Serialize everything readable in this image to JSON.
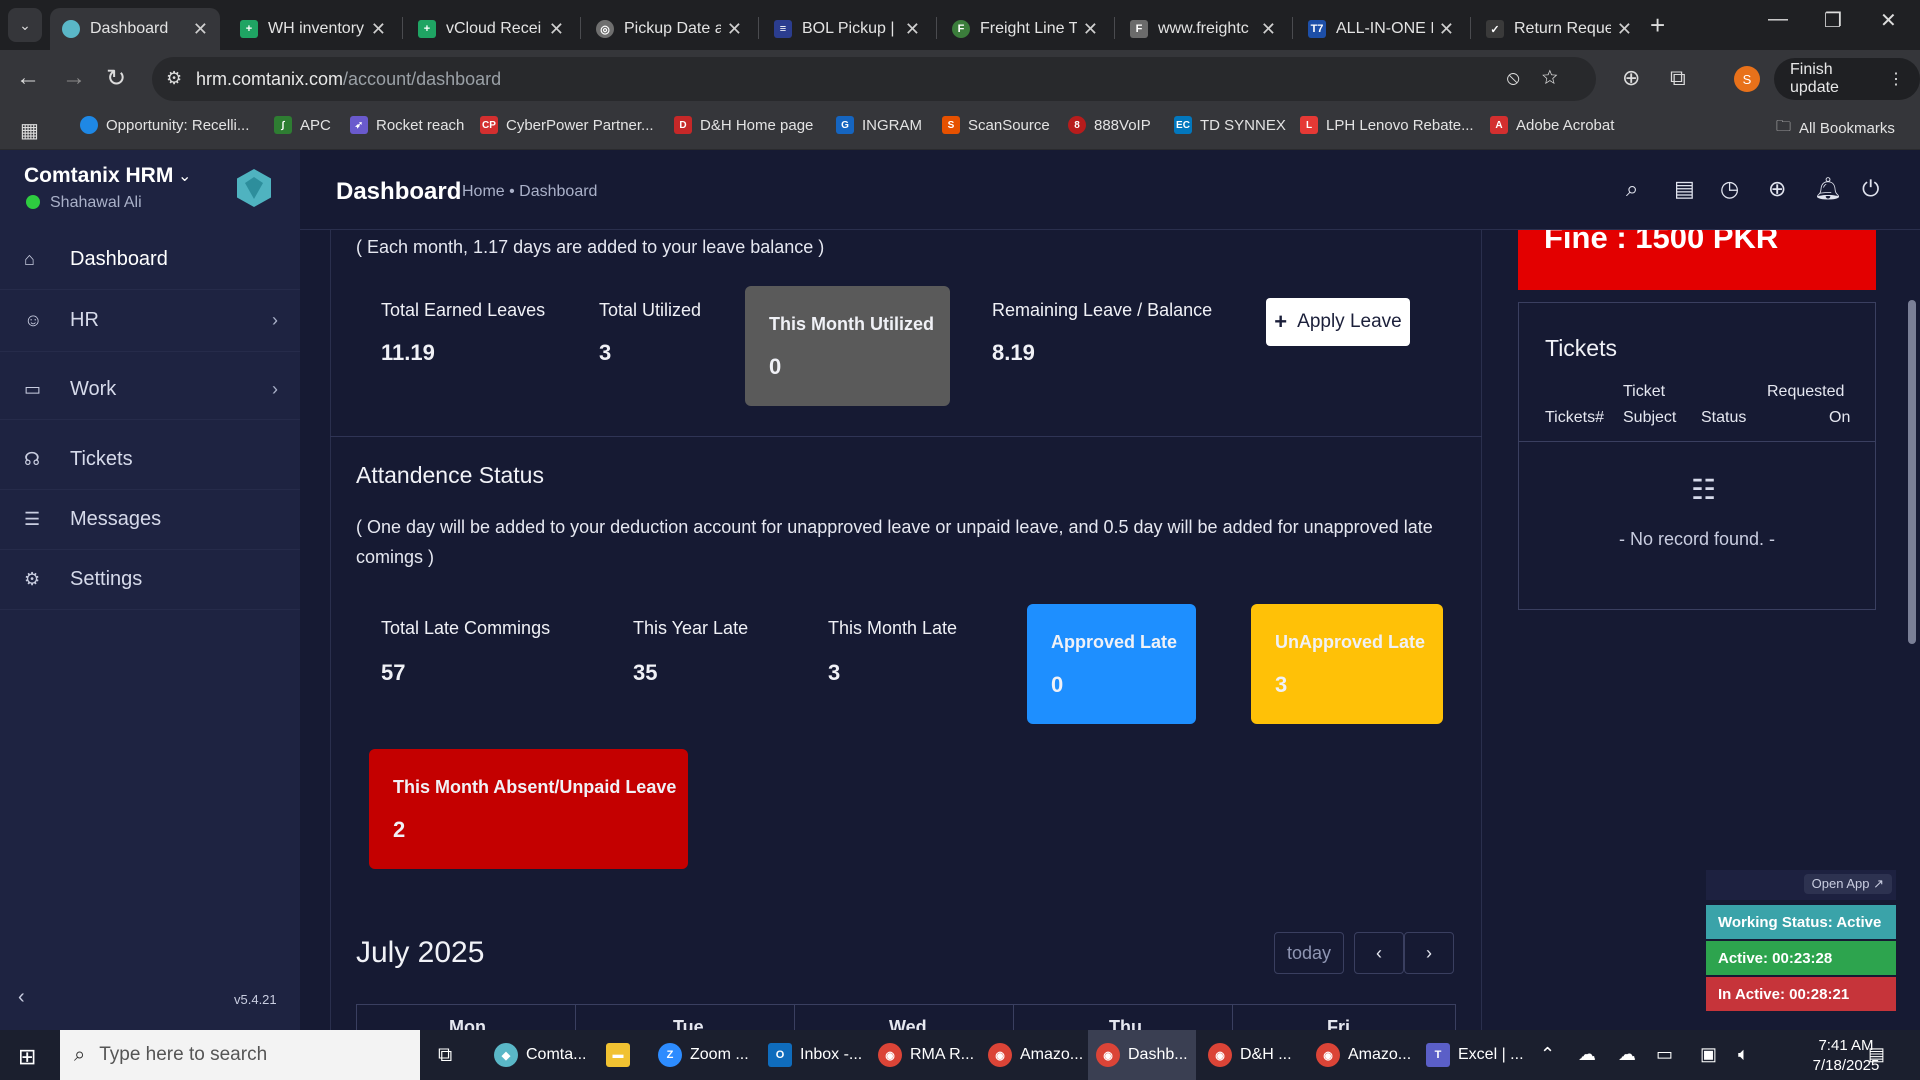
{
  "browser": {
    "tabs": [
      {
        "title": "Dashboard",
        "icon": "hrm-logo-icon",
        "color": "#5ab7c7",
        "active": true
      },
      {
        "title": "WH inventory",
        "icon": "sheets-icon",
        "color": "#1fa463"
      },
      {
        "title": "vCloud Recei",
        "icon": "sheets-icon",
        "color": "#1fa463"
      },
      {
        "title": "Pickup Date a",
        "icon": "globe-icon",
        "color": "#6f6f6f"
      },
      {
        "title": "BOL Pickup |",
        "icon": "carrier-icon",
        "color": "#2b3d8f"
      },
      {
        "title": "Freight Line T",
        "icon": "freight-icon",
        "color": "#3b7d3b"
      },
      {
        "title": "www.freightc",
        "icon": "fcc-icon",
        "color": "#6b6b6b"
      },
      {
        "title": "ALL-IN-ONE I",
        "icon": "t7-icon",
        "color": "#1d4fa8"
      },
      {
        "title": "Return Reque",
        "icon": "check-icon",
        "color": "#3a3a3a"
      }
    ],
    "url_host": "hrm.comtanix.com",
    "url_path": "/account/dashboard",
    "profile_initial": "S",
    "finish_update": "Finish update",
    "bookmarks": [
      {
        "label": "Opportunity: Recelli...",
        "color": "#1e88e5"
      },
      {
        "label": "APC",
        "color": "#2e7d32"
      },
      {
        "label": "Rocket reach",
        "color": "#6a5acd"
      },
      {
        "label": "CyberPower Partner...",
        "color": "#d32f2f"
      },
      {
        "label": "D&H Home page",
        "color": "#c62828"
      },
      {
        "label": "INGRAM",
        "color": "#1565c0"
      },
      {
        "label": "ScanSource",
        "color": "#e65100"
      },
      {
        "label": "888VoIP",
        "color": "#b71c1c"
      },
      {
        "label": "TD SYNNEX",
        "color": "#0277bd"
      },
      {
        "label": "LPH Lenovo Rebate...",
        "color": "#e53935"
      },
      {
        "label": "Adobe Acrobat",
        "color": "#d32f2f"
      }
    ],
    "all_bookmarks": "All Bookmarks"
  },
  "sidebar": {
    "brand": "Comtanix HRM",
    "user": "Shahawal Ali",
    "items": [
      {
        "label": "Dashboard",
        "icon": "home-icon"
      },
      {
        "label": "HR",
        "icon": "users-icon"
      },
      {
        "label": "Work",
        "icon": "briefcase-icon"
      },
      {
        "label": "Tickets",
        "icon": "headset-icon"
      },
      {
        "label": "Messages",
        "icon": "chat-icon"
      },
      {
        "label": "Settings",
        "icon": "gear-icon"
      }
    ],
    "version": "v5.4.21"
  },
  "header": {
    "title": "Dashboard",
    "breadcrumb": "Home • Dashboard"
  },
  "leave": {
    "note": "( Each month, 1.17 days are added to your leave balance )",
    "stats": [
      {
        "label": "Total Earned Leaves",
        "value": "11.19"
      },
      {
        "label": "Total Utilized",
        "value": "3"
      },
      {
        "label": "This Month Utilized",
        "value": "0"
      },
      {
        "label": "Remaining Leave / Balance",
        "value": "8.19"
      }
    ],
    "apply_button": "Apply Leave"
  },
  "attendance": {
    "title": "Attandence Status",
    "note_line1": "( One day will be added to your deduction account for unapproved leave or unpaid leave, and 0.5 day will be added for unapproved late",
    "note_line2": "comings )",
    "stats": [
      {
        "label": "Total Late Commings",
        "value": "57"
      },
      {
        "label": "This Year Late",
        "value": "35"
      },
      {
        "label": "This Month Late",
        "value": "3"
      },
      {
        "label": "Approved Late",
        "value": "0",
        "color": "#1e8fff"
      },
      {
        "label": "UnApproved Late",
        "value": "3",
        "color": "#ffc107"
      },
      {
        "label": "This Month Absent/Unpaid Leave",
        "value": "2",
        "color": "#c40000"
      }
    ]
  },
  "fine": {
    "text": "Fine : 1500 PKR"
  },
  "tickets": {
    "title": "Tickets",
    "col1": "Tickets#",
    "col2a": "Ticket",
    "col2b": "Subject",
    "col3": "Status",
    "col4a": "Requested",
    "col4b": "On",
    "empty": "- No record found. -"
  },
  "calendar": {
    "title": "July 2025",
    "today": "today",
    "days": [
      "Mon",
      "Tue",
      "Wed",
      "Thu",
      "Fri"
    ]
  },
  "tracker": {
    "open_app": "Open App ↗",
    "working_status": "Working Status: Active",
    "active": "Active: 00:23:28",
    "inactive": "In Active: 00:28:21",
    "colors": {
      "status": "#3aa3a9",
      "active": "#2da44e",
      "inactive": "#c6343a"
    }
  },
  "taskbar": {
    "search_placeholder": "Type here to search",
    "apps": [
      {
        "label": "Comta...",
        "color": "#5ab7c7"
      },
      {
        "label": "",
        "color": "#f1c232"
      },
      {
        "label": "Zoom ...",
        "color": "#2d8cff"
      },
      {
        "label": "Inbox -...",
        "color": "#0f6cbd"
      },
      {
        "label": "RMA R...",
        "color": "#db4437"
      },
      {
        "label": "Amazo...",
        "color": "#db4437"
      },
      {
        "label": "Dashb...",
        "color": "#db4437",
        "active": true
      },
      {
        "label": "D&H ...",
        "color": "#db4437"
      },
      {
        "label": "Amazo...",
        "color": "#db4437"
      },
      {
        "label": "Excel | ...",
        "color": "#5b5fc7"
      }
    ],
    "time": "7:41 AM",
    "date": "7/18/2025"
  }
}
